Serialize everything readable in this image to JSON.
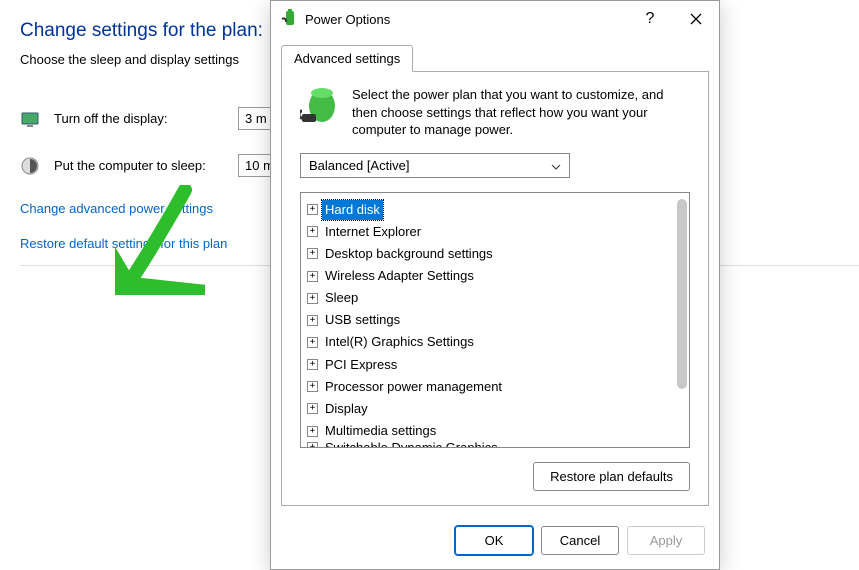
{
  "bg": {
    "heading": "Change settings for the plan:",
    "subtext": "Choose the sleep and display settings",
    "rows": [
      {
        "label": "Turn off the display:",
        "value": "3 m"
      },
      {
        "label": "Put the computer to sleep:",
        "value": "10 m"
      }
    ],
    "link_advanced": "Change advanced power settings",
    "link_restore": "Restore default settings for this plan"
  },
  "dialog": {
    "title": "Power Options",
    "tab_label": "Advanced settings",
    "intro": "Select the power plan that you want to customize, and then choose settings that reflect how you want your computer to manage power.",
    "plan_name": "Balanced [Active]",
    "tree_items": [
      "Hard disk",
      "Internet Explorer",
      "Desktop background settings",
      "Wireless Adapter Settings",
      "Sleep",
      "USB settings",
      "Intel(R) Graphics Settings",
      "PCI Express",
      "Processor power management",
      "Display",
      "Multimedia settings",
      "Switchable Dynamic Graphics"
    ],
    "restore_btn": "Restore plan defaults",
    "ok": "OK",
    "cancel": "Cancel",
    "apply": "Apply"
  }
}
